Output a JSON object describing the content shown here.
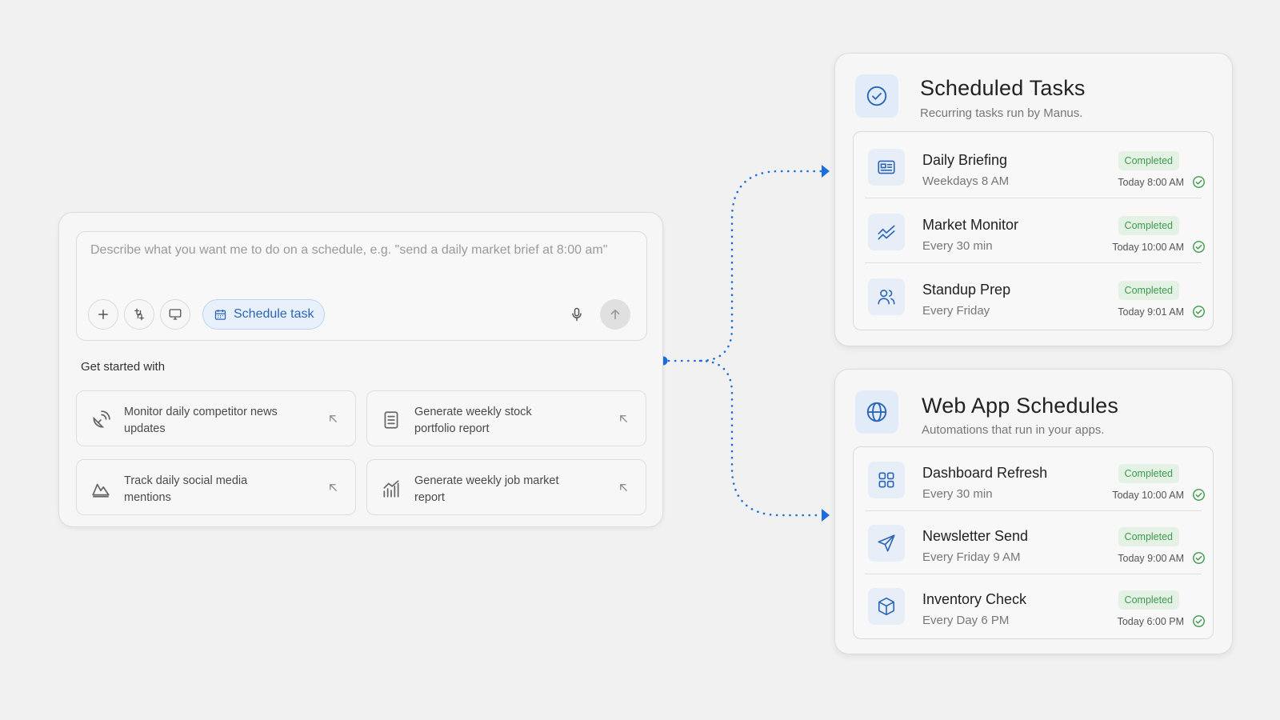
{
  "composer": {
    "placeholder": "Describe what you want me to do on a schedule, e.g. \"send a daily market brief at 8:00 am\"",
    "tools": [
      {
        "name": "add-icon"
      },
      {
        "name": "connectors-icon"
      },
      {
        "name": "computer-icon"
      }
    ],
    "schedule_chip": {
      "label": "Schedule task",
      "icon": "calendar-icon"
    },
    "mic_icon": "microphone-icon",
    "send_icon": "arrow-up-icon",
    "get_started_label": "Get started with",
    "suggestions": [
      {
        "text": "Monitor daily competitor news updates",
        "icon": "satellite-dish-icon"
      },
      {
        "text": "Generate weekly stock portfolio report",
        "icon": "document-icon"
      },
      {
        "text": "Track daily social media mentions",
        "icon": "mountain-chart-icon"
      },
      {
        "text": "Generate weekly job market report",
        "icon": "bar-trend-icon"
      }
    ]
  },
  "scheduled_tasks": {
    "title": "Scheduled Tasks",
    "subtitle": "Recurring tasks run by Manus.",
    "icon": "check-circle-icon",
    "items": [
      {
        "title": "Daily Briefing",
        "schedule": "Weekdays 8 AM",
        "status": "Completed",
        "last_run": "Today 8:00 AM",
        "icon": "newspaper-icon"
      },
      {
        "title": "Market Monitor",
        "schedule": "Every 30 min",
        "status": "Completed",
        "last_run": "Today 10:00 AM",
        "icon": "trend-chart-icon"
      },
      {
        "title": "Standup Prep",
        "schedule": "Every Friday",
        "status": "Completed",
        "last_run": "Today 9:01 AM",
        "icon": "users-icon"
      }
    ]
  },
  "web_app_schedules": {
    "title": "Web App Schedules",
    "subtitle": "Automations that run in your apps.",
    "icon": "globe-icon",
    "items": [
      {
        "title": "Dashboard Refresh",
        "schedule": "Every 30 min",
        "status": "Completed",
        "last_run": "Today 10:00 AM",
        "icon": "grid-icon"
      },
      {
        "title": "Newsletter Send",
        "schedule": "Every Friday 9 AM",
        "status": "Completed",
        "last_run": "Today 9:00 AM",
        "icon": "send-icon"
      },
      {
        "title": "Inventory Check",
        "schedule": "Every Day 6 PM",
        "status": "Completed",
        "last_run": "Today 6:00 PM",
        "icon": "box-icon"
      }
    ]
  },
  "colors": {
    "accent": "#1a6ee0",
    "success": "#3f9a4d",
    "background": "#f1f1f1"
  }
}
